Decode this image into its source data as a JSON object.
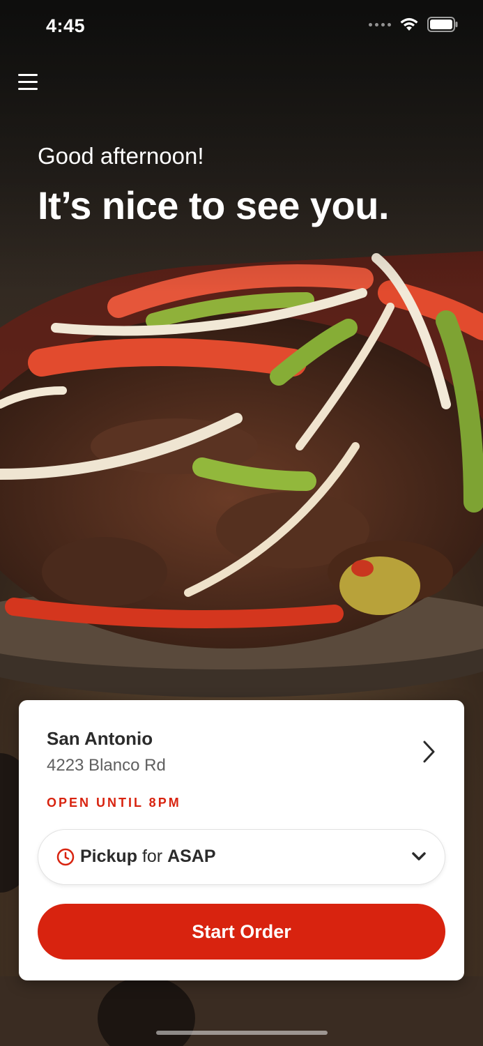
{
  "status_bar": {
    "time": "4:45"
  },
  "header": {
    "greeting": "Good afternoon!",
    "headline": "It’s nice to see you."
  },
  "location": {
    "name": "San Antonio",
    "address": "4223 Blanco Rd",
    "hours": "OPEN UNTIL 8PM"
  },
  "order_mode": {
    "mode": "Pickup",
    "connector": "for",
    "time": "ASAP"
  },
  "actions": {
    "start_order": "Start Order"
  },
  "colors": {
    "accent": "#d8230f",
    "card": "#ffffff",
    "text_dark": "#2b2b2b"
  },
  "icons": [
    "menu-icon",
    "chevron-right-icon",
    "clock-icon",
    "chevron-down-icon",
    "wifi-icon",
    "battery-icon",
    "signal-icon"
  ]
}
